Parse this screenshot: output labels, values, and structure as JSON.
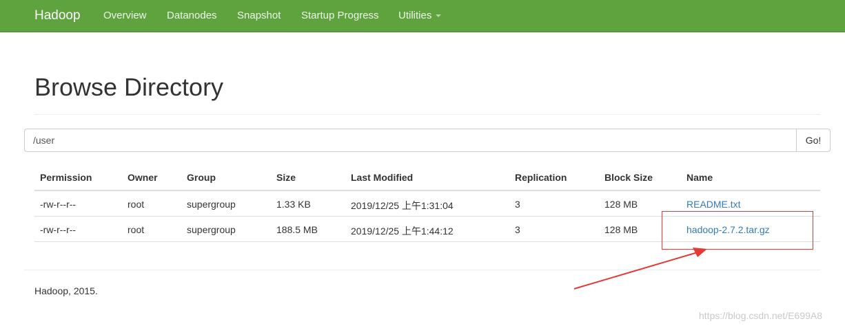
{
  "navbar": {
    "brand": "Hadoop",
    "items": [
      {
        "label": "Overview"
      },
      {
        "label": "Datanodes"
      },
      {
        "label": "Snapshot"
      },
      {
        "label": "Startup Progress"
      },
      {
        "label": "Utilities"
      }
    ]
  },
  "page": {
    "title": "Browse Directory"
  },
  "path_bar": {
    "value": "/user",
    "go_label": "Go!"
  },
  "table": {
    "headers": [
      "Permission",
      "Owner",
      "Group",
      "Size",
      "Last Modified",
      "Replication",
      "Block Size",
      "Name"
    ],
    "rows": [
      {
        "permission": "-rw-r--r--",
        "owner": "root",
        "group": "supergroup",
        "size": "1.33 KB",
        "last_modified": "2019/12/25 上午1:31:04",
        "replication": "3",
        "block_size": "128 MB",
        "name": "README.txt"
      },
      {
        "permission": "-rw-r--r--",
        "owner": "root",
        "group": "supergroup",
        "size": "188.5 MB",
        "last_modified": "2019/12/25 上午1:44:12",
        "replication": "3",
        "block_size": "128 MB",
        "name": "hadoop-2.7.2.tar.gz"
      }
    ]
  },
  "footer": {
    "text": "Hadoop, 2015."
  },
  "watermark": {
    "text": "https://blog.csdn.net/E699A8"
  },
  "colors": {
    "navbar_bg": "#5fa33e",
    "link": "#337ab7",
    "annotation": "#e53935"
  }
}
